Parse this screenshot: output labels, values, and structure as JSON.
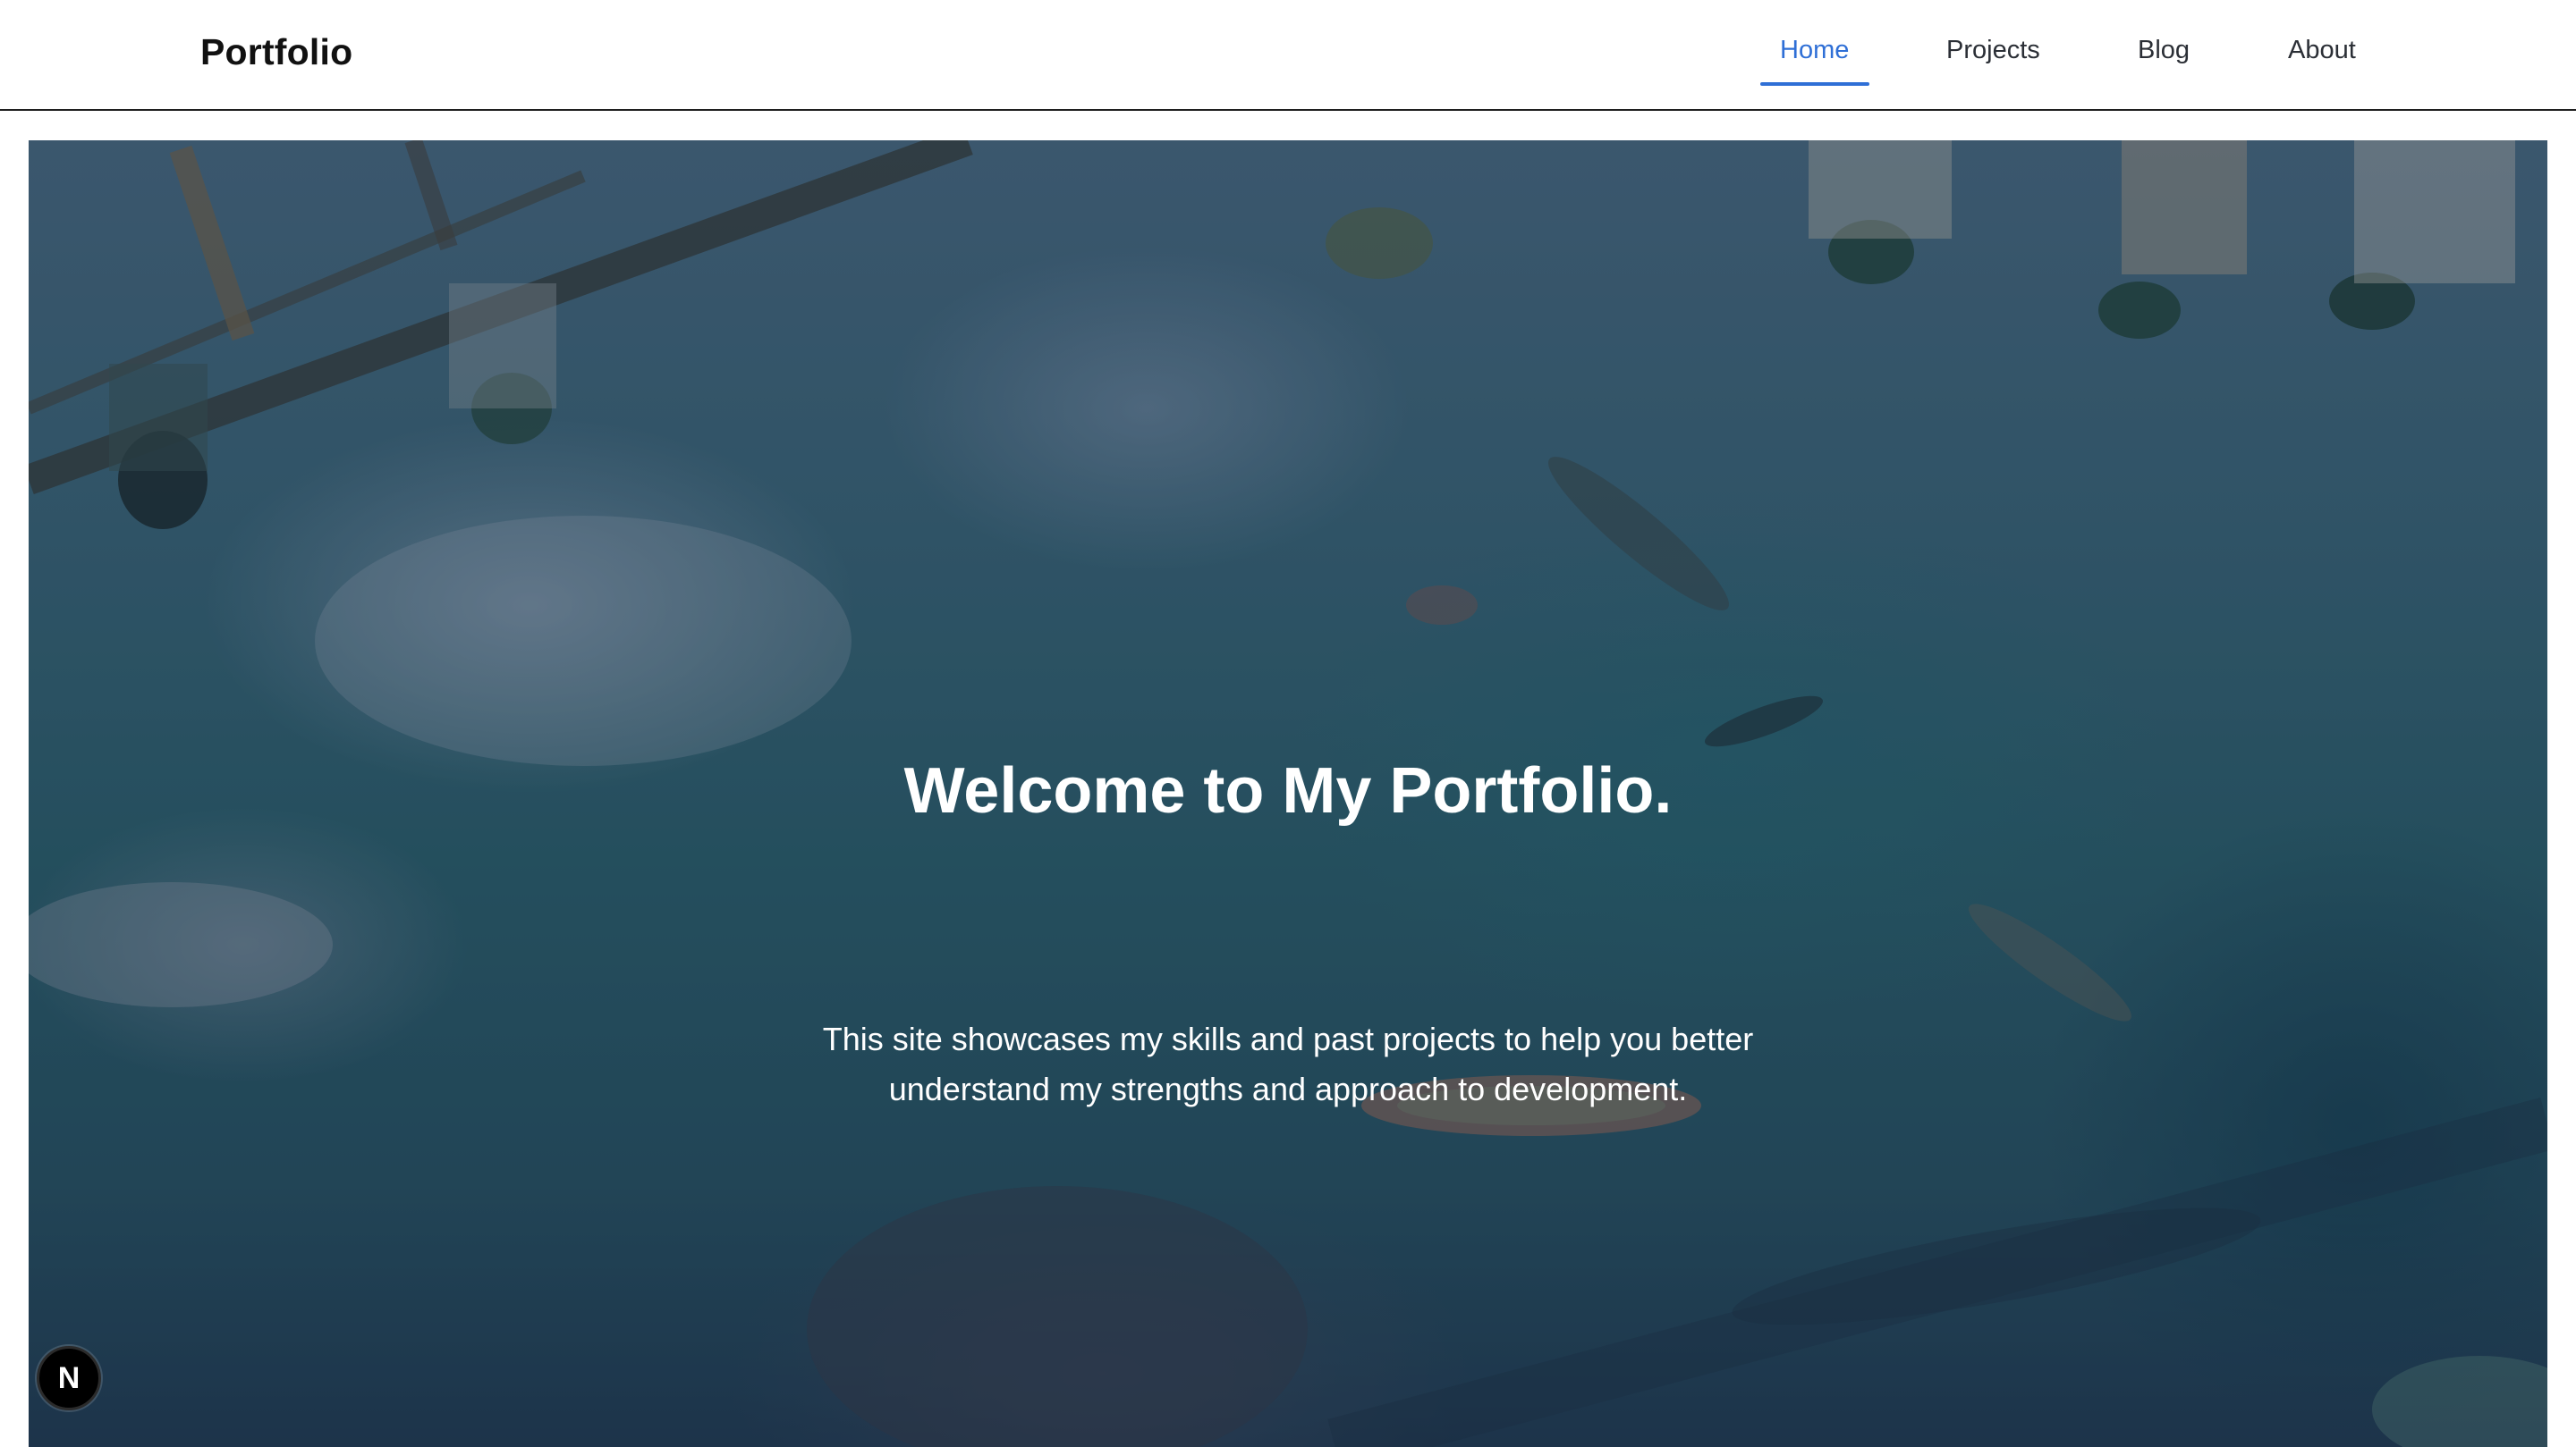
{
  "header": {
    "brand": "Portfolio",
    "nav": [
      {
        "label": "Home",
        "active": true
      },
      {
        "label": "Projects",
        "active": false
      },
      {
        "label": "Blog",
        "active": false
      },
      {
        "label": "About",
        "active": false
      }
    ]
  },
  "hero": {
    "title": "Welcome to My Portfolio.",
    "subtitle": "This site showcases my skills and past projects to help you better understand my strengths and approach to development.",
    "background_image": "underwater-fish-reflection-photo"
  },
  "dev_badge": {
    "label": "N",
    "icon": "nextjs-logo-icon"
  },
  "colors": {
    "accent": "#2f6fd6",
    "nav_text": "#2b2f36",
    "brand_text": "#111111",
    "hero_text": "#ffffff"
  }
}
